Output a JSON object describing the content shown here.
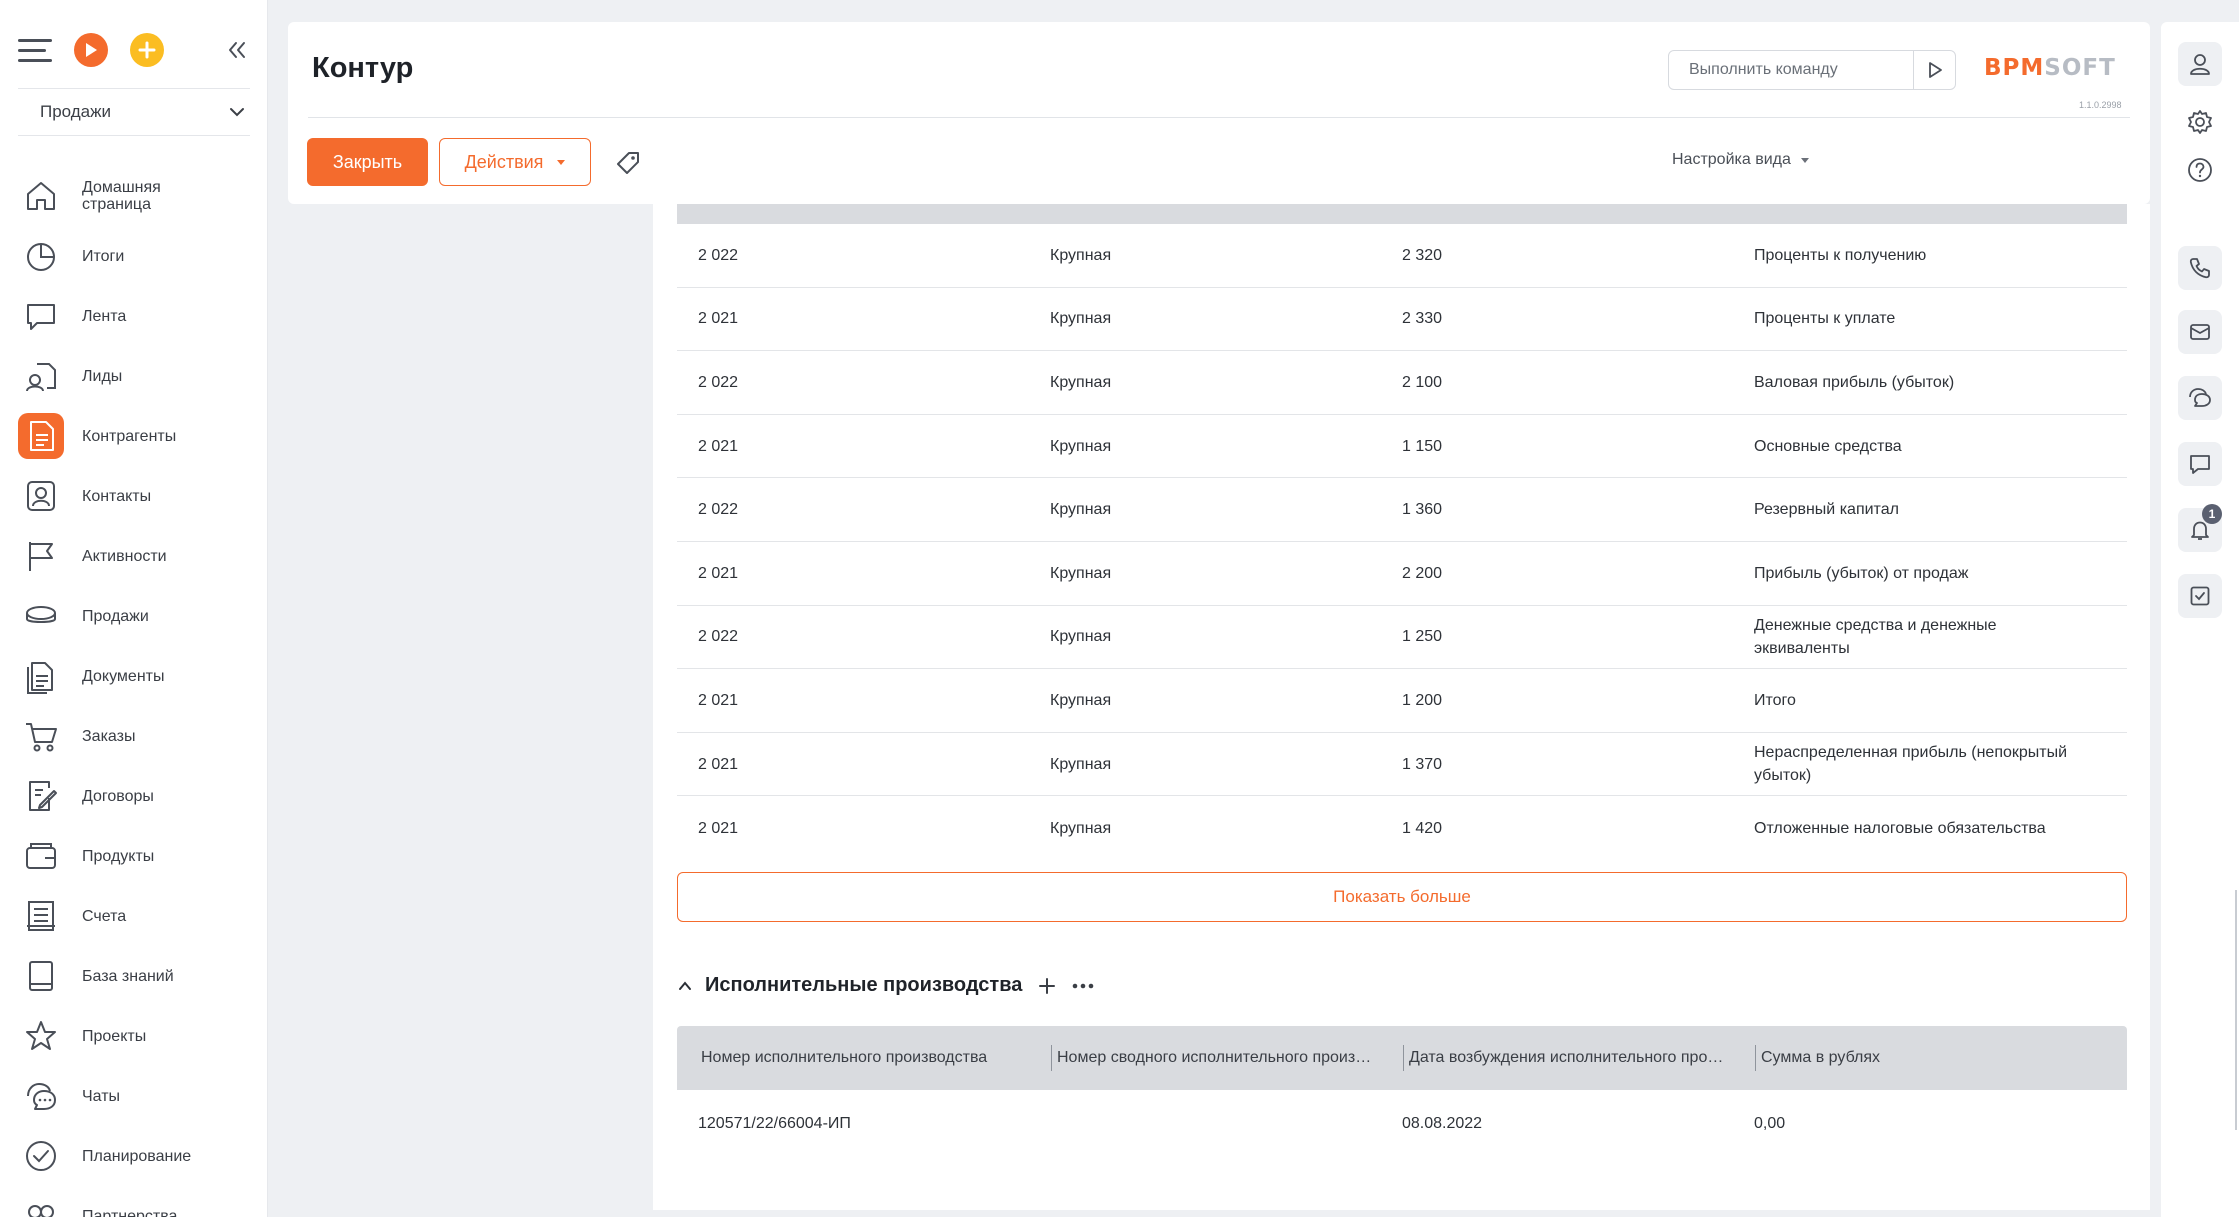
{
  "app": {
    "workspace": "Продажи",
    "version": "1.1.0.2998",
    "logo": {
      "primary": "BPM",
      "secondary": "SOFT"
    },
    "accent_color": "#f46b2d"
  },
  "sidebar": {
    "items": [
      {
        "label": "Домашняя страница",
        "icon": "home-icon"
      },
      {
        "label": "Итоги",
        "icon": "pie-chart-icon"
      },
      {
        "label": "Лента",
        "icon": "feed-icon"
      },
      {
        "label": "Лиды",
        "icon": "leads-icon"
      },
      {
        "label": "Контрагенты",
        "icon": "accounts-icon",
        "active": true
      },
      {
        "label": "Контакты",
        "icon": "contacts-icon"
      },
      {
        "label": "Активности",
        "icon": "flag-icon"
      },
      {
        "label": "Продажи",
        "icon": "opportunities-icon"
      },
      {
        "label": "Документы",
        "icon": "documents-icon"
      },
      {
        "label": "Заказы",
        "icon": "cart-icon"
      },
      {
        "label": "Договоры",
        "icon": "contract-icon"
      },
      {
        "label": "Продукты",
        "icon": "products-icon"
      },
      {
        "label": "Счета",
        "icon": "invoice-icon"
      },
      {
        "label": "База знаний",
        "icon": "knowledge-icon"
      },
      {
        "label": "Проекты",
        "icon": "star-icon"
      },
      {
        "label": "Чаты",
        "icon": "chats-icon"
      },
      {
        "label": "Планирование",
        "icon": "check-circle-icon"
      },
      {
        "label": "Партнерства",
        "icon": "partners-icon"
      }
    ]
  },
  "header": {
    "title": "Контур",
    "command_placeholder": "Выполнить команду",
    "close_label": "Закрыть",
    "actions_label": "Действия",
    "view_settings_label": "Настройка вида"
  },
  "financial_rows": [
    {
      "year": "2 022",
      "category": "Крупная",
      "code": "2 320",
      "indicator": "Проценты к получению"
    },
    {
      "year": "2 021",
      "category": "Крупная",
      "code": "2 330",
      "indicator": "Проценты к уплате"
    },
    {
      "year": "2 022",
      "category": "Крупная",
      "code": "2 100",
      "indicator": "Валовая прибыль (убыток)"
    },
    {
      "year": "2 021",
      "category": "Крупная",
      "code": "1 150",
      "indicator": "Основные средства"
    },
    {
      "year": "2 022",
      "category": "Крупная",
      "code": "1 360",
      "indicator": "Резервный капитал"
    },
    {
      "year": "2 021",
      "category": "Крупная",
      "code": "2 200",
      "indicator": "Прибыль (убыток) от продаж"
    },
    {
      "year": "2 022",
      "category": "Крупная",
      "code": "1 250",
      "indicator": "Денежные средства и денежные эквиваленты"
    },
    {
      "year": "2 021",
      "category": "Крупная",
      "code": "1 200",
      "indicator": "Итого"
    },
    {
      "year": "2 021",
      "category": "Крупная",
      "code": "1 370",
      "indicator": "Нераспределенная прибыль (непокрытый убыток)"
    },
    {
      "year": "2 021",
      "category": "Крупная",
      "code": "1 420",
      "indicator": "Отложенные налоговые обязательства"
    }
  ],
  "show_more_label": "Показать больше",
  "enforcement": {
    "title": "Исполнительные производства",
    "columns": [
      "Номер исполнительного производства",
      "Номер сводного исполнительного произ…",
      "Дата возбуждения исполнительного про…",
      "Сумма в рублях"
    ],
    "rows": [
      {
        "number": "120571/22/66004-ИП",
        "summary_number": "",
        "date": "08.08.2022",
        "amount": "0,00"
      }
    ]
  },
  "right_panel": {
    "notifications_count": "1"
  }
}
